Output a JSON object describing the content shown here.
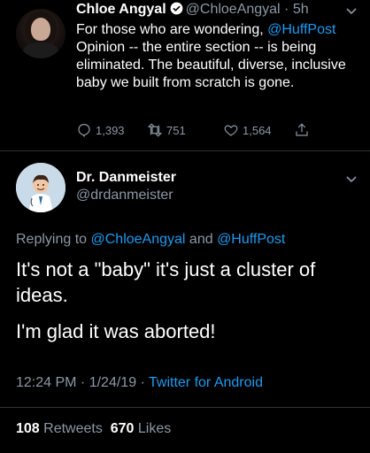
{
  "original_tweet": {
    "author_name": "Chloe Angyal",
    "author_handle": "@ChloeAngyal",
    "time": "5h",
    "text_before": "For those who are wondering, ",
    "mention": "@HuffPost",
    "text_after": " Opinion -- the entire section -- is being eliminated. The beautiful, diverse, inclusive baby we built from scratch is gone.",
    "replies": "1,393",
    "retweets": "751",
    "likes": "1,564"
  },
  "reply_tweet": {
    "author_name": "Dr. Danmeister",
    "author_handle": "@drdanmeister",
    "replying_to_prefix": "Replying to ",
    "replying_to_1": "@ChloeAngyal",
    "replying_to_and": " and ",
    "replying_to_2": "@HuffPost",
    "paragraph_1": "It's not a \"baby\" it's just a cluster of ideas.",
    "paragraph_2": "I'm glad it was aborted!",
    "timestamp": "12:24 PM · 1/24/19 · ",
    "source": "Twitter for Android",
    "retweet_count": "108",
    "retweet_label": "Retweets",
    "like_count": "670",
    "like_label": "Likes"
  },
  "colors": {
    "background": "#000000",
    "text": "#ffffff",
    "secondary": "#8b98a5",
    "link": "#1d9bf0"
  }
}
